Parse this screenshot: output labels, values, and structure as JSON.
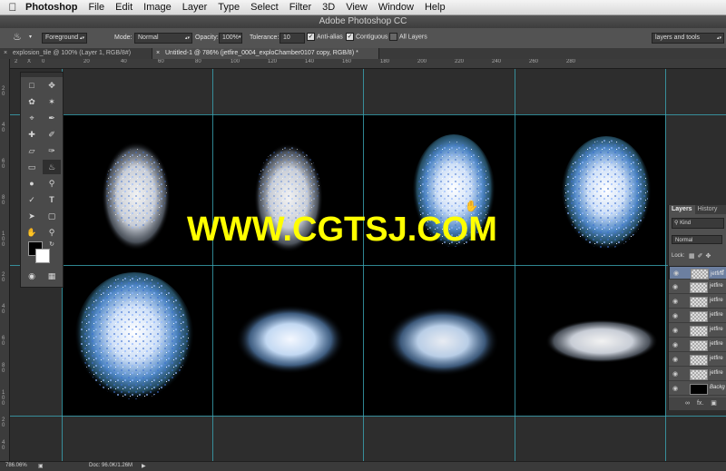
{
  "menubar": {
    "app": "Photoshop",
    "items": [
      "File",
      "Edit",
      "Image",
      "Layer",
      "Type",
      "Select",
      "Filter",
      "3D",
      "View",
      "Window",
      "Help"
    ]
  },
  "window": {
    "title": "Adobe Photoshop CC"
  },
  "options": {
    "fill_source": "Foreground",
    "mode_label": "Mode:",
    "mode_value": "Normal",
    "opacity_label": "Opacity:",
    "opacity_value": "100%",
    "tolerance_label": "Tolerance:",
    "tolerance_value": "10",
    "anti_alias": "Anti-alias",
    "contiguous": "Contiguous",
    "all_layers": "All Layers",
    "workspace": "layers and tools"
  },
  "tabs": [
    {
      "label": "explosion_tile @ 100% (Layer 1, RGB/8#)",
      "active": false
    },
    {
      "label": "Untitled-1 @ 786% (jetfire_0004_exploChamber0107 copy, RGB/8) *",
      "active": true
    }
  ],
  "ruler_top": [
    "2",
    "X",
    "0",
    "20",
    "40",
    "60",
    "80",
    "100",
    "120",
    "140",
    "160",
    "180",
    "200",
    "220",
    "240",
    "260",
    "280"
  ],
  "ruler_left": [
    "20",
    "40",
    "60",
    "80",
    "100",
    "20",
    "40",
    "60",
    "80",
    "100",
    "20",
    "40"
  ],
  "watermark": "WWW.CGTSJ.COM",
  "layers_panel": {
    "tab_layers": "Layers",
    "tab_history": "History",
    "kind": "Kind",
    "blend": "Normal",
    "lock": "Lock:",
    "layers": [
      "jetfire",
      "jetfire",
      "jetfire",
      "jetfire",
      "jetfire",
      "jetfire",
      "jetfire",
      "jetfire",
      "Backg"
    ],
    "footer_fx": "fx."
  },
  "status": {
    "zoom": "786.06%",
    "doc": "Doc: 96.0K/1.26M"
  },
  "colors": {
    "guide": "#3aa5b4",
    "watermark": "#ffff00",
    "selected_layer": "#6c7fa0"
  }
}
